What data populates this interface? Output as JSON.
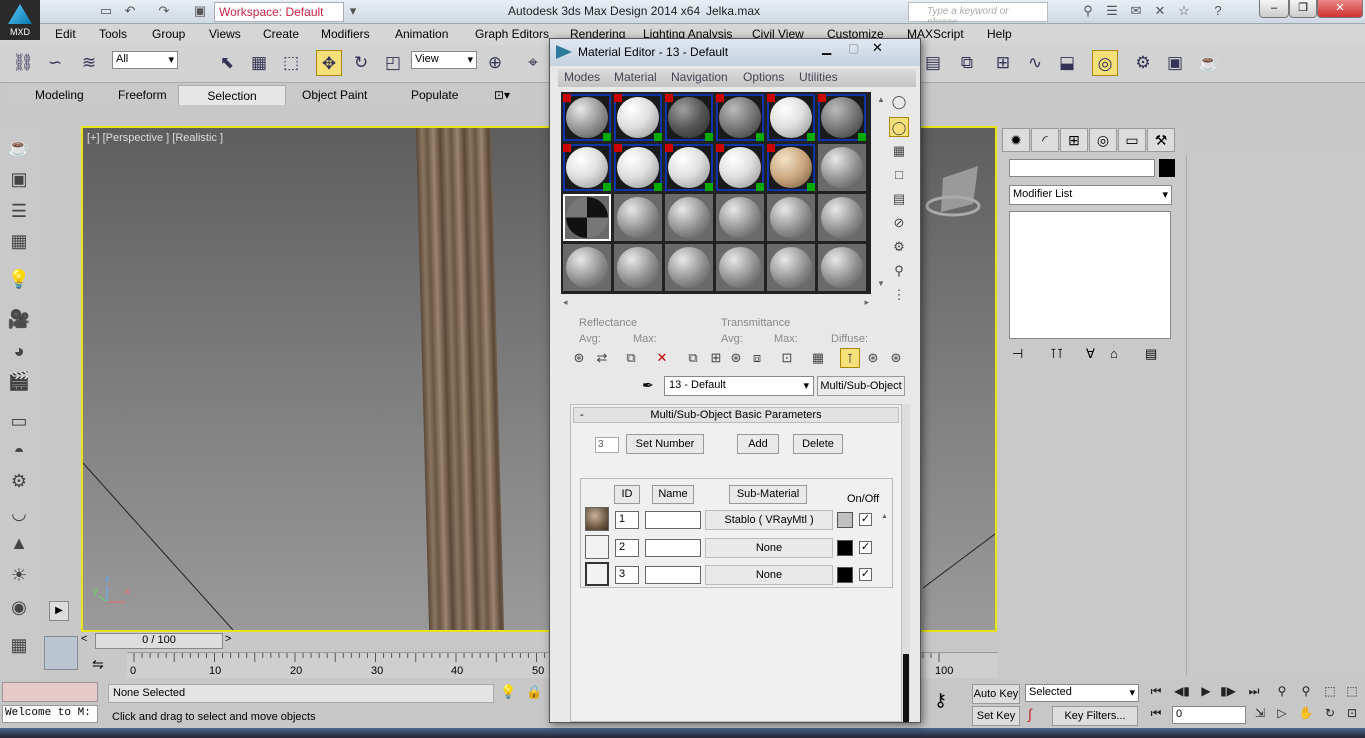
{
  "app": {
    "logo_text": "MXD",
    "title": "Autodesk 3ds Max Design 2014 x64",
    "file": "Jelka.max",
    "workspace": "Workspace: Default",
    "search_placeholder": "Type a keyword or phrase"
  },
  "menu": [
    "Edit",
    "Tools",
    "Group",
    "Views",
    "Create",
    "Modifiers",
    "Animation",
    "Graph Editors",
    "Rendering",
    "Lighting Analysis",
    "Civil View",
    "Customize",
    "MAXScript",
    "Help"
  ],
  "toolbar": {
    "filter": "All",
    "ref_coord": "View"
  },
  "ribbon": {
    "tabs": [
      "Modeling",
      "Freeform",
      "Selection",
      "Object Paint",
      "Populate"
    ],
    "active": "Selection"
  },
  "viewport": {
    "label": "[+] [Perspective ] [Realistic ]",
    "axis_z": "z",
    "axis_y": "y",
    "axis_x": "x"
  },
  "timeline": {
    "slider": "0 / 100",
    "ticks": [
      "0",
      "10",
      "20",
      "30",
      "40",
      "50",
      "100"
    ]
  },
  "status": {
    "welcome": "Welcome to M:",
    "selection": "None Selected",
    "hint": "Click and drag to select and move objects",
    "auto_key": "Auto Key",
    "set_key": "Set Key",
    "key_mode": "Selected",
    "key_filters": "Key Filters...",
    "frame": "0"
  },
  "command_panel": {
    "modifier_list": "Modifier List"
  },
  "material_editor": {
    "title": "Material Editor - 13 - Default",
    "menus": [
      "Modes",
      "Material",
      "Navigation",
      "Options",
      "Utilities"
    ],
    "reflectance": "Reflectance",
    "transmittance": "Transmittance",
    "avg": "Avg:",
    "max": "Max:",
    "diffuse": "Diffuse:",
    "material_name": "13 - Default",
    "material_type": "Multi/Sub-Object",
    "rollout_title": "Multi/Sub-Object Basic Parameters",
    "rollout_toggle": "-",
    "num_materials": "3",
    "set_number": "Set Number",
    "add": "Add",
    "delete": "Delete",
    "col_id": "ID",
    "col_name": "Name",
    "col_sub": "Sub-Material",
    "col_onoff": "On/Off",
    "rows": [
      {
        "id": "1",
        "name": "",
        "sub": "Stablo  ( VRayMtl )",
        "swatch": "#c0c0c0",
        "on": "✓"
      },
      {
        "id": "2",
        "name": "",
        "sub": "None",
        "swatch": "#000000",
        "on": "✓"
      },
      {
        "id": "3",
        "name": "",
        "sub": "None",
        "swatch": "#000000",
        "on": "✓"
      }
    ]
  }
}
